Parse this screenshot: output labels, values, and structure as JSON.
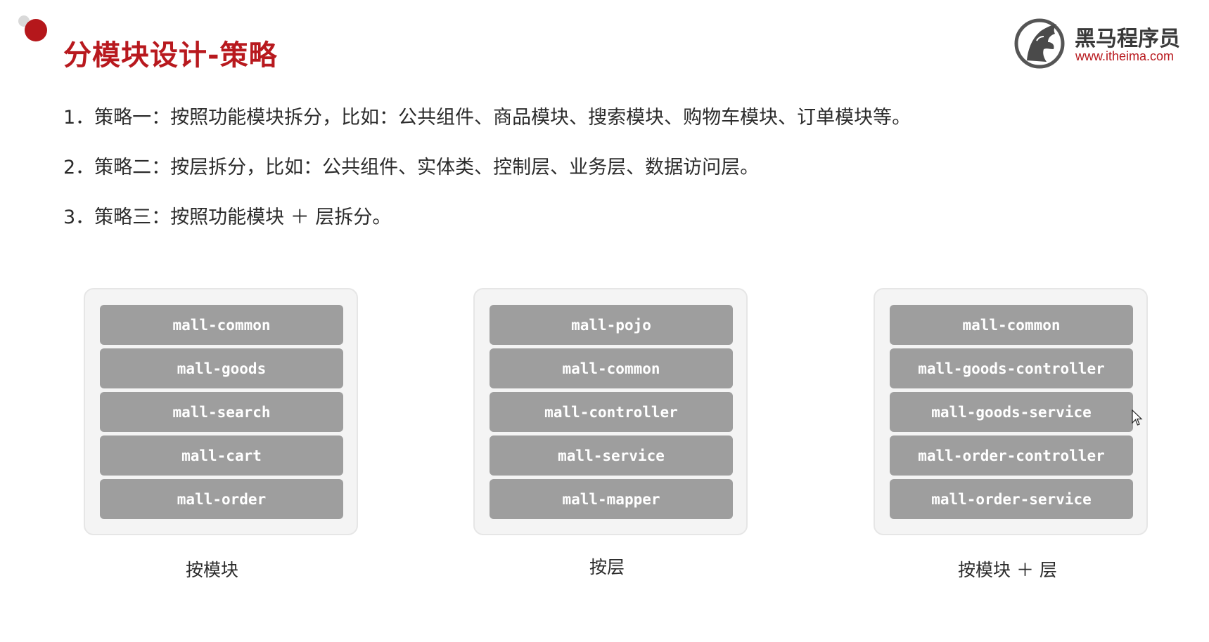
{
  "slide": {
    "title": "分模块设计-策略"
  },
  "logo": {
    "name": "黑马程序员",
    "url": "www.itheima.com",
    "icon": "horse-head-logo"
  },
  "strategies": [
    "1．策略一：按照功能模块拆分，比如：公共组件、商品模块、搜索模块、购物车模块、订单模块等。",
    "2．策略二：按层拆分，比如：公共组件、实体类、控制层、业务层、数据访问层。",
    "3．策略三：按照功能模块 ＋ 层拆分。"
  ],
  "panels": [
    {
      "caption": "按模块",
      "modules": [
        "mall-common",
        "mall-goods",
        "mall-search",
        "mall-cart",
        "mall-order"
      ]
    },
    {
      "caption": "按层",
      "modules": [
        "mall-pojo",
        "mall-common",
        "mall-controller",
        "mall-service",
        "mall-mapper"
      ]
    },
    {
      "caption": "按模块 ＋ 层",
      "modules": [
        "mall-common",
        "mall-goods-controller",
        "mall-goods-service",
        "mall-order-controller",
        "mall-order-service"
      ]
    }
  ],
  "colors": {
    "accent": "#b8191e",
    "module_fill": "#9e9e9e",
    "panel_fill": "#f4f4f4"
  }
}
